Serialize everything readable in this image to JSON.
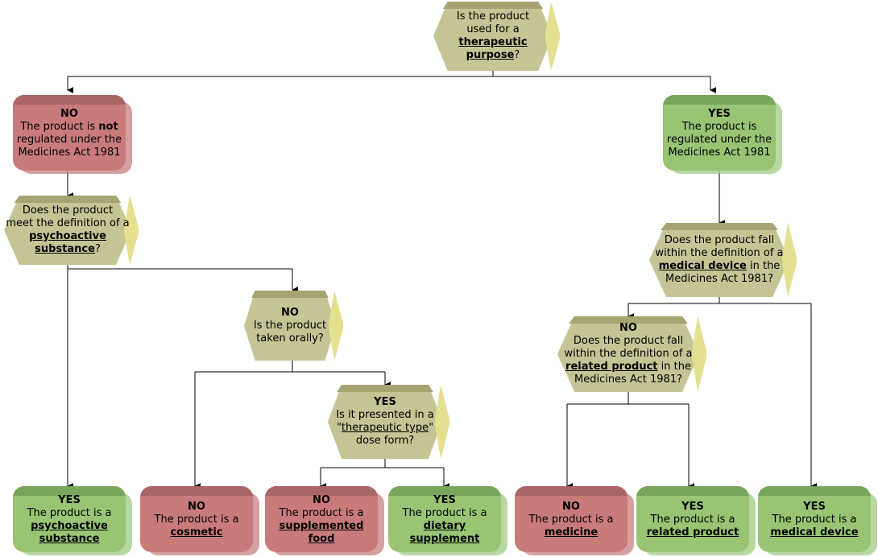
{
  "diagram": {
    "title": "Medicines Act 1981 product classification decision tree",
    "colors": {
      "decision_fill": "#c5c495",
      "decision_bevel": "#e3e08f",
      "decision_top": "#a6a472",
      "no_fill": "#c97b7b",
      "yes_fill": "#98c474",
      "connector": "#000000",
      "background": "#ffffff"
    },
    "nodes": [
      {
        "id": "q-therapeutic-purpose",
        "shape": "hexagon",
        "lines": [
          {
            "text": "Is the product",
            "style": "plain"
          },
          {
            "text": "used for a",
            "style": "plain"
          },
          {
            "text": "therapeutic",
            "style": "underline-bold"
          },
          {
            "text": "purpose?",
            "style": "underline-bold-q"
          }
        ]
      },
      {
        "id": "no-not-regulated",
        "shape": "terminal",
        "color": "red",
        "lines": [
          {
            "text": "NO",
            "style": "bold"
          },
          {
            "text": "The product is not",
            "style": "plain-not"
          },
          {
            "text": "regulated under the",
            "style": "plain"
          },
          {
            "text": "Medicines Act 1981",
            "style": "plain"
          }
        ]
      },
      {
        "id": "yes-regulated",
        "shape": "terminal",
        "color": "green",
        "lines": [
          {
            "text": "YES",
            "style": "bold"
          },
          {
            "text": "The product is",
            "style": "plain"
          },
          {
            "text": "regulated under the",
            "style": "plain"
          },
          {
            "text": "Medicines Act 1981",
            "style": "plain"
          }
        ]
      },
      {
        "id": "q-psychoactive-substance",
        "shape": "hexagon",
        "lines": [
          {
            "text": "Does the product",
            "style": "plain"
          },
          {
            "text": "meet the definition of a",
            "style": "plain"
          },
          {
            "text": "psychoactive",
            "style": "underline-bold"
          },
          {
            "text": "substance?",
            "style": "underline-bold-q"
          }
        ]
      },
      {
        "id": "q-medical-device",
        "shape": "hexagon",
        "lines": [
          {
            "text": "Does the product fall",
            "style": "plain"
          },
          {
            "text": "within the definition of a",
            "style": "plain"
          },
          {
            "text": "medical device in the",
            "style": "underline-bold-tail"
          },
          {
            "text": "Medicines Act 1981?",
            "style": "plain"
          }
        ]
      },
      {
        "id": "q-taken-orally",
        "shape": "hexagon",
        "lines": [
          {
            "text": "NO",
            "style": "bold"
          },
          {
            "text": "Is the product",
            "style": "plain"
          },
          {
            "text": "taken orally?",
            "style": "plain"
          }
        ]
      },
      {
        "id": "q-related-product",
        "shape": "hexagon",
        "lines": [
          {
            "text": "NO",
            "style": "bold"
          },
          {
            "text": "Does the product fall",
            "style": "plain"
          },
          {
            "text": "within the definition of a",
            "style": "plain"
          },
          {
            "text": "related product in the",
            "style": "underline-bold-tail"
          },
          {
            "text": "Medicines Act 1981?",
            "style": "plain"
          }
        ]
      },
      {
        "id": "q-dose-form",
        "shape": "hexagon",
        "lines": [
          {
            "text": "YES",
            "style": "bold"
          },
          {
            "text": "Is it presented in a",
            "style": "plain"
          },
          {
            "text": "\"therapeutic type\"",
            "style": "quoted-underline"
          },
          {
            "text": "dose form?",
            "style": "plain"
          }
        ]
      },
      {
        "id": "res-psychoactive-substance",
        "shape": "terminal",
        "color": "green",
        "lines": [
          {
            "text": "YES",
            "style": "bold"
          },
          {
            "text": "The product is a",
            "style": "plain"
          },
          {
            "text": "psychoactive",
            "style": "underline-bold"
          },
          {
            "text": "substance",
            "style": "underline-bold"
          }
        ]
      },
      {
        "id": "res-cosmetic",
        "shape": "terminal",
        "color": "red",
        "lines": [
          {
            "text": "NO",
            "style": "bold"
          },
          {
            "text": "The product is a",
            "style": "plain"
          },
          {
            "text": "cosmetic",
            "style": "underline-bold"
          }
        ]
      },
      {
        "id": "res-supplemented-food",
        "shape": "terminal",
        "color": "red",
        "lines": [
          {
            "text": "NO",
            "style": "bold"
          },
          {
            "text": "The product is a",
            "style": "plain"
          },
          {
            "text": "supplemented",
            "style": "underline-bold"
          },
          {
            "text": "food",
            "style": "underline-bold"
          }
        ]
      },
      {
        "id": "res-dietary-supplement",
        "shape": "terminal",
        "color": "green",
        "lines": [
          {
            "text": "YES",
            "style": "bold"
          },
          {
            "text": "The product is a",
            "style": "plain"
          },
          {
            "text": "dietary",
            "style": "underline-bold"
          },
          {
            "text": "supplement",
            "style": "underline-bold"
          }
        ]
      },
      {
        "id": "res-medicine",
        "shape": "terminal",
        "color": "red",
        "lines": [
          {
            "text": "NO",
            "style": "bold"
          },
          {
            "text": "The product is a",
            "style": "plain"
          },
          {
            "text": "medicine",
            "style": "underline-bold"
          }
        ]
      },
      {
        "id": "res-related-product",
        "shape": "terminal",
        "color": "green",
        "lines": [
          {
            "text": "YES",
            "style": "bold"
          },
          {
            "text": "The product is a",
            "style": "plain"
          },
          {
            "text": "related product",
            "style": "underline-bold"
          }
        ]
      },
      {
        "id": "res-medical-device",
        "shape": "terminal",
        "color": "green",
        "lines": [
          {
            "text": "YES",
            "style": "bold"
          },
          {
            "text": "The product is a",
            "style": "plain"
          },
          {
            "text": "medical device",
            "style": "underline-bold"
          }
        ]
      }
    ]
  }
}
